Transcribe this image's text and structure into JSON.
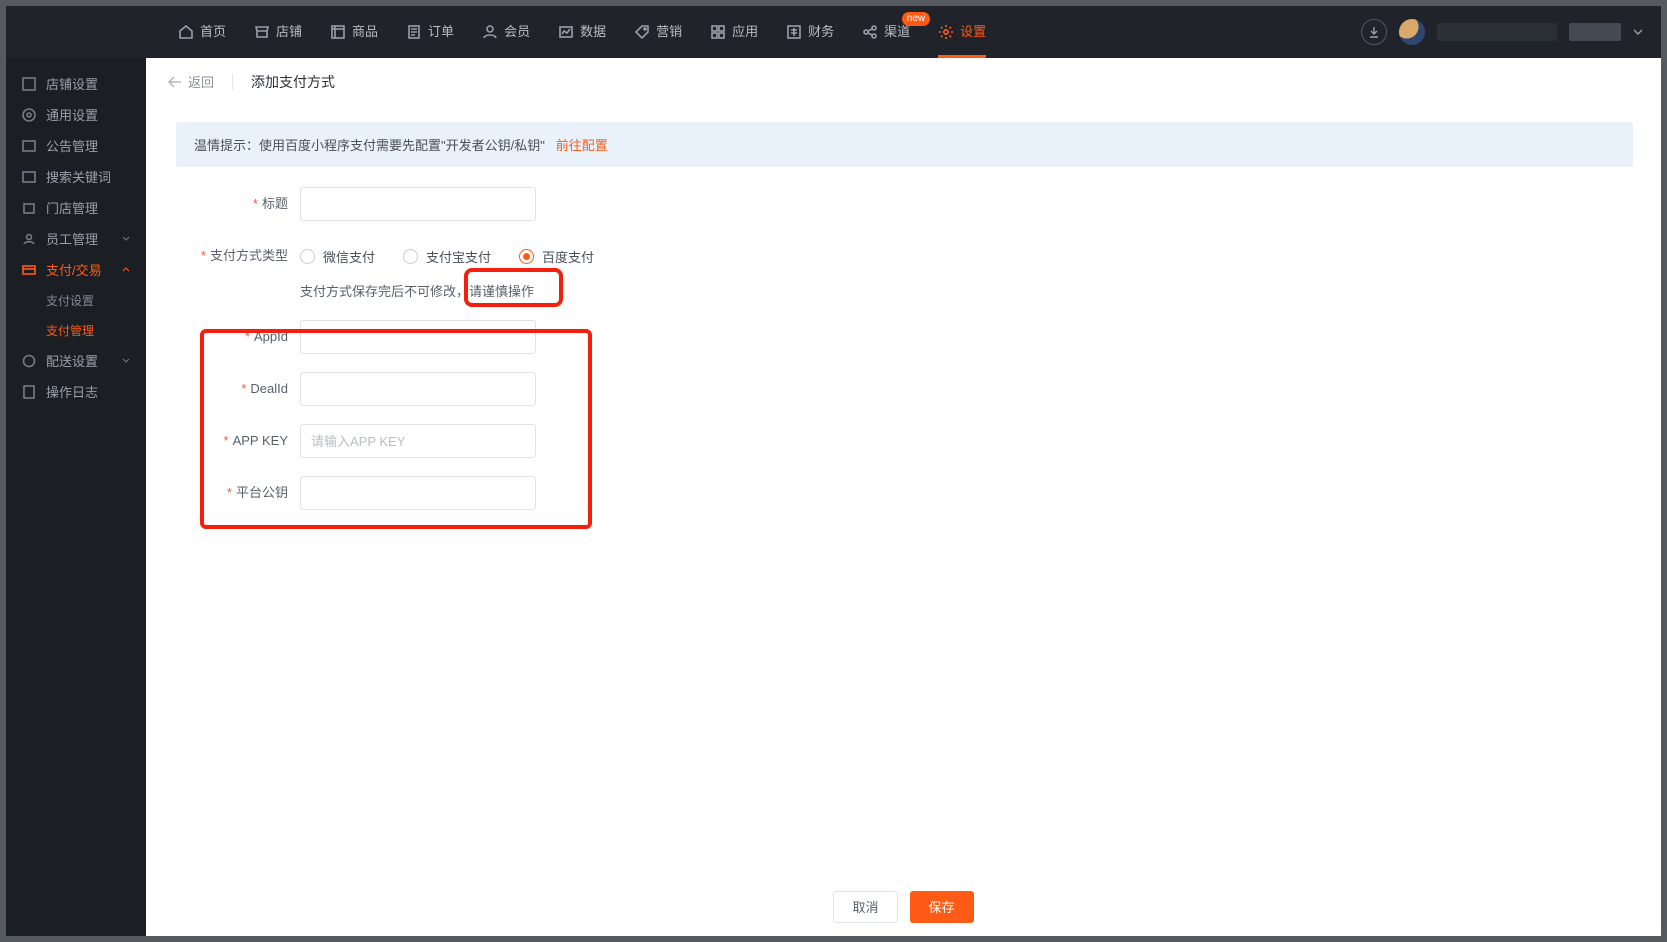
{
  "nav": {
    "items": [
      {
        "label": "首页"
      },
      {
        "label": "店铺"
      },
      {
        "label": "商品"
      },
      {
        "label": "订单"
      },
      {
        "label": "会员"
      },
      {
        "label": "数据"
      },
      {
        "label": "营销"
      },
      {
        "label": "应用"
      },
      {
        "label": "财务"
      },
      {
        "label": "渠道",
        "badge": "new"
      },
      {
        "label": "设置",
        "active": true
      }
    ]
  },
  "sidebar": {
    "items": [
      {
        "label": "店铺设置"
      },
      {
        "label": "通用设置"
      },
      {
        "label": "公告管理"
      },
      {
        "label": "搜索关键词"
      },
      {
        "label": "门店管理"
      },
      {
        "label": "员工管理",
        "chev": "down"
      },
      {
        "label": "支付/交易",
        "active": true,
        "chev": "up",
        "subs": [
          {
            "label": "支付设置"
          },
          {
            "label": "支付管理",
            "active": true
          }
        ]
      },
      {
        "label": "配送设置",
        "chev": "down"
      },
      {
        "label": "操作日志"
      }
    ]
  },
  "page": {
    "back": "返回",
    "title": "添加支付方式"
  },
  "tip": {
    "text": "温情提示：使用百度小程序支付需要先配置\"开发者公钥/私钥\"",
    "link": "前往配置"
  },
  "form": {
    "title_label": "标题",
    "type_label": "支付方式类型",
    "radios": [
      {
        "label": "微信支付"
      },
      {
        "label": "支付宝支付"
      },
      {
        "label": "百度支付"
      }
    ],
    "help": "支付方式保存完后不可修改，请谨慎操作",
    "appid_label": "AppId",
    "dealid_label": "DealId",
    "appkey_label": "APP KEY",
    "appkey_placeholder": "请输入APP KEY",
    "pubkey_label": "平台公钥"
  },
  "footer": {
    "cancel": "取消",
    "save": "保存"
  }
}
